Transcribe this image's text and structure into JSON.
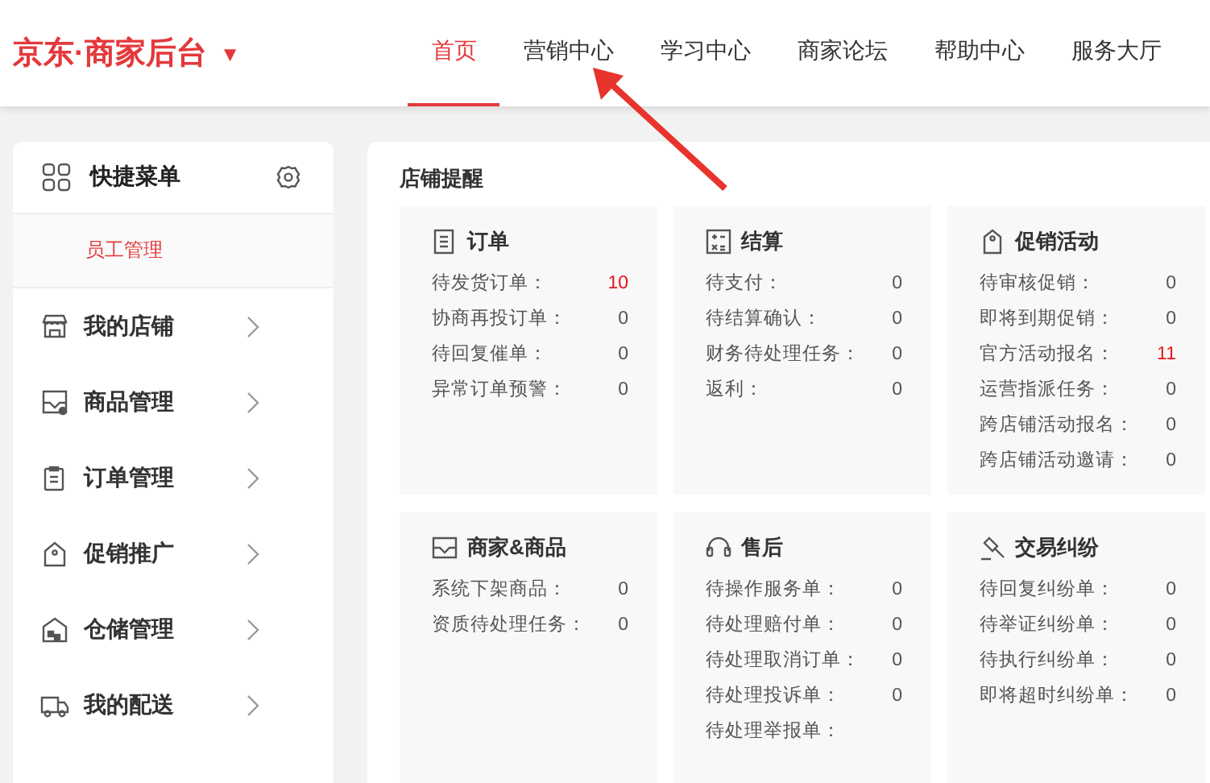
{
  "header": {
    "logo": "京东·商家后台",
    "caret": "▼",
    "nav": [
      {
        "label": "首页",
        "selected": true
      },
      {
        "label": "营销中心",
        "selected": false
      },
      {
        "label": "学习中心",
        "selected": false
      },
      {
        "label": "商家论坛",
        "selected": false
      },
      {
        "label": "帮助中心",
        "selected": false
      },
      {
        "label": "服务大厅",
        "selected": false
      }
    ]
  },
  "sidebar": {
    "title": "快捷菜单",
    "quick_items": [
      "员工管理"
    ],
    "items": [
      {
        "label": "我的店铺"
      },
      {
        "label": "商品管理"
      },
      {
        "label": "订单管理"
      },
      {
        "label": "促销推广"
      },
      {
        "label": "仓储管理"
      },
      {
        "label": "我的配送"
      }
    ]
  },
  "reminders": {
    "title": "店铺提醒",
    "cards": [
      {
        "title": "订单",
        "rows": [
          {
            "label": "待发货订单：",
            "value": "10",
            "highlight": true
          },
          {
            "label": "协商再投订单：",
            "value": "0",
            "highlight": false
          },
          {
            "label": "待回复催单：",
            "value": "0",
            "highlight": false
          },
          {
            "label": "异常订单预警：",
            "value": "0",
            "highlight": false
          }
        ]
      },
      {
        "title": "结算",
        "rows": [
          {
            "label": "待支付：",
            "value": "0",
            "highlight": false
          },
          {
            "label": "待结算确认：",
            "value": "0",
            "highlight": false
          },
          {
            "label": "财务待处理任务：",
            "value": "0",
            "highlight": false
          },
          {
            "label": "返利：",
            "value": "0",
            "highlight": false
          }
        ]
      },
      {
        "title": "促销活动",
        "rows": [
          {
            "label": "待审核促销：",
            "value": "0",
            "highlight": false
          },
          {
            "label": "即将到期促销：",
            "value": "0",
            "highlight": false
          },
          {
            "label": "官方活动报名：",
            "value": "11",
            "highlight": true
          },
          {
            "label": "运营指派任务：",
            "value": "0",
            "highlight": false
          },
          {
            "label": "跨店铺活动报名：",
            "value": "0",
            "highlight": false
          },
          {
            "label": "跨店铺活动邀请：",
            "value": "0",
            "highlight": false
          }
        ]
      },
      {
        "title": "商家&商品",
        "rows": [
          {
            "label": "系统下架商品：",
            "value": "0",
            "highlight": false
          },
          {
            "label": "资质待处理任务：",
            "value": "0",
            "highlight": false
          }
        ]
      },
      {
        "title": "售后",
        "rows": [
          {
            "label": "待操作服务单：",
            "value": "0",
            "highlight": false
          },
          {
            "label": "待处理赔付单：",
            "value": "0",
            "highlight": false
          },
          {
            "label": "待处理取消订单：",
            "value": "0",
            "highlight": false
          },
          {
            "label": "待处理投诉单：",
            "value": "0",
            "highlight": false
          },
          {
            "label": "待处理举报单："
          }
        ]
      },
      {
        "title": "交易纠纷",
        "rows": [
          {
            "label": "待回复纠纷单：",
            "value": "0",
            "highlight": false
          },
          {
            "label": "待举证纠纷单：",
            "value": "0",
            "highlight": false
          },
          {
            "label": "待执行纠纷单：",
            "value": "0",
            "highlight": false
          },
          {
            "label": "即将超时纠纷单：",
            "value": "0",
            "highlight": false
          }
        ]
      }
    ]
  }
}
